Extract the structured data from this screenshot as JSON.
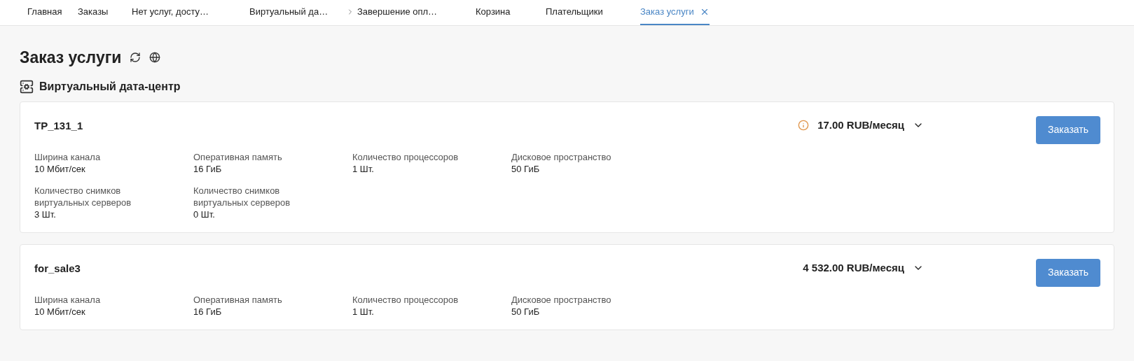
{
  "tabs": [
    {
      "label": "Главная",
      "selected": false,
      "chevron": false
    },
    {
      "label": "Заказы",
      "selected": false,
      "chevron": false
    },
    {
      "label": "Нет услуг, досту…",
      "selected": false,
      "chevron": false
    },
    {
      "label": "Виртуальный да…",
      "selected": false,
      "chevron": false
    },
    {
      "label": "Завершение опл…",
      "selected": false,
      "chevron": true
    },
    {
      "label": "Корзина",
      "selected": false,
      "chevron": false
    },
    {
      "label": "Плательщики",
      "selected": false,
      "chevron": false
    },
    {
      "label": "Заказ услуги",
      "selected": true,
      "chevron": false
    }
  ],
  "page_title": "Заказ услуги",
  "section_title": "Виртуальный дата-центр",
  "plans": [
    {
      "name": "TP_131_1",
      "info": true,
      "price": "17.00 RUB/месяц",
      "button": "Заказать",
      "specs": [
        {
          "label": "Ширина канала",
          "value": "10 Мбит/сек"
        },
        {
          "label": "Оперативная память",
          "value": "16 ГиБ"
        },
        {
          "label": "Количество процессоров",
          "value": "1 Шт."
        },
        {
          "label": "Дисковое пространство",
          "value": "50 ГиБ"
        },
        {
          "label": "Количество снимков виртуальных серверов",
          "value": "3 Шт."
        },
        {
          "label": "Количество снимков виртуальных серверов",
          "value": "0 Шт."
        }
      ]
    },
    {
      "name": "for_sale3",
      "info": false,
      "price": "4 532.00 RUB/месяц",
      "button": "Заказать",
      "specs": [
        {
          "label": "Ширина канала",
          "value": "10 Мбит/сек"
        },
        {
          "label": "Оперативная память",
          "value": "16 ГиБ"
        },
        {
          "label": "Количество процессоров",
          "value": "1 Шт."
        },
        {
          "label": "Дисковое пространство",
          "value": "50 ГиБ"
        }
      ]
    }
  ]
}
